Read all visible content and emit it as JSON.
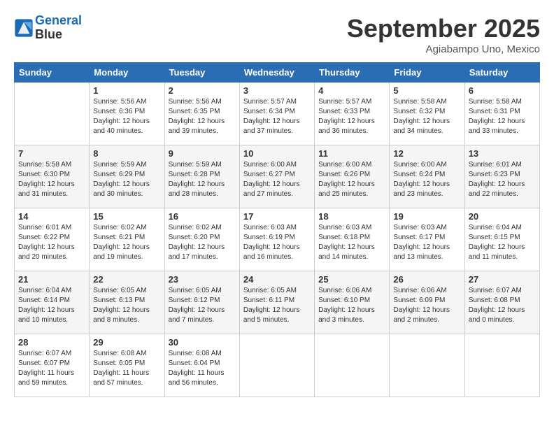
{
  "header": {
    "logo_line1": "General",
    "logo_line2": "Blue",
    "month": "September 2025",
    "location": "Agiabampo Uno, Mexico"
  },
  "days_of_week": [
    "Sunday",
    "Monday",
    "Tuesday",
    "Wednesday",
    "Thursday",
    "Friday",
    "Saturday"
  ],
  "weeks": [
    [
      {
        "day": "",
        "info": ""
      },
      {
        "day": "1",
        "info": "Sunrise: 5:56 AM\nSunset: 6:36 PM\nDaylight: 12 hours\nand 40 minutes."
      },
      {
        "day": "2",
        "info": "Sunrise: 5:56 AM\nSunset: 6:35 PM\nDaylight: 12 hours\nand 39 minutes."
      },
      {
        "day": "3",
        "info": "Sunrise: 5:57 AM\nSunset: 6:34 PM\nDaylight: 12 hours\nand 37 minutes."
      },
      {
        "day": "4",
        "info": "Sunrise: 5:57 AM\nSunset: 6:33 PM\nDaylight: 12 hours\nand 36 minutes."
      },
      {
        "day": "5",
        "info": "Sunrise: 5:58 AM\nSunset: 6:32 PM\nDaylight: 12 hours\nand 34 minutes."
      },
      {
        "day": "6",
        "info": "Sunrise: 5:58 AM\nSunset: 6:31 PM\nDaylight: 12 hours\nand 33 minutes."
      }
    ],
    [
      {
        "day": "7",
        "info": "Sunrise: 5:58 AM\nSunset: 6:30 PM\nDaylight: 12 hours\nand 31 minutes."
      },
      {
        "day": "8",
        "info": "Sunrise: 5:59 AM\nSunset: 6:29 PM\nDaylight: 12 hours\nand 30 minutes."
      },
      {
        "day": "9",
        "info": "Sunrise: 5:59 AM\nSunset: 6:28 PM\nDaylight: 12 hours\nand 28 minutes."
      },
      {
        "day": "10",
        "info": "Sunrise: 6:00 AM\nSunset: 6:27 PM\nDaylight: 12 hours\nand 27 minutes."
      },
      {
        "day": "11",
        "info": "Sunrise: 6:00 AM\nSunset: 6:26 PM\nDaylight: 12 hours\nand 25 minutes."
      },
      {
        "day": "12",
        "info": "Sunrise: 6:00 AM\nSunset: 6:24 PM\nDaylight: 12 hours\nand 23 minutes."
      },
      {
        "day": "13",
        "info": "Sunrise: 6:01 AM\nSunset: 6:23 PM\nDaylight: 12 hours\nand 22 minutes."
      }
    ],
    [
      {
        "day": "14",
        "info": "Sunrise: 6:01 AM\nSunset: 6:22 PM\nDaylight: 12 hours\nand 20 minutes."
      },
      {
        "day": "15",
        "info": "Sunrise: 6:02 AM\nSunset: 6:21 PM\nDaylight: 12 hours\nand 19 minutes."
      },
      {
        "day": "16",
        "info": "Sunrise: 6:02 AM\nSunset: 6:20 PM\nDaylight: 12 hours\nand 17 minutes."
      },
      {
        "day": "17",
        "info": "Sunrise: 6:03 AM\nSunset: 6:19 PM\nDaylight: 12 hours\nand 16 minutes."
      },
      {
        "day": "18",
        "info": "Sunrise: 6:03 AM\nSunset: 6:18 PM\nDaylight: 12 hours\nand 14 minutes."
      },
      {
        "day": "19",
        "info": "Sunrise: 6:03 AM\nSunset: 6:17 PM\nDaylight: 12 hours\nand 13 minutes."
      },
      {
        "day": "20",
        "info": "Sunrise: 6:04 AM\nSunset: 6:15 PM\nDaylight: 12 hours\nand 11 minutes."
      }
    ],
    [
      {
        "day": "21",
        "info": "Sunrise: 6:04 AM\nSunset: 6:14 PM\nDaylight: 12 hours\nand 10 minutes."
      },
      {
        "day": "22",
        "info": "Sunrise: 6:05 AM\nSunset: 6:13 PM\nDaylight: 12 hours\nand 8 minutes."
      },
      {
        "day": "23",
        "info": "Sunrise: 6:05 AM\nSunset: 6:12 PM\nDaylight: 12 hours\nand 7 minutes."
      },
      {
        "day": "24",
        "info": "Sunrise: 6:05 AM\nSunset: 6:11 PM\nDaylight: 12 hours\nand 5 minutes."
      },
      {
        "day": "25",
        "info": "Sunrise: 6:06 AM\nSunset: 6:10 PM\nDaylight: 12 hours\nand 3 minutes."
      },
      {
        "day": "26",
        "info": "Sunrise: 6:06 AM\nSunset: 6:09 PM\nDaylight: 12 hours\nand 2 minutes."
      },
      {
        "day": "27",
        "info": "Sunrise: 6:07 AM\nSunset: 6:08 PM\nDaylight: 12 hours\nand 0 minutes."
      }
    ],
    [
      {
        "day": "28",
        "info": "Sunrise: 6:07 AM\nSunset: 6:07 PM\nDaylight: 11 hours\nand 59 minutes."
      },
      {
        "day": "29",
        "info": "Sunrise: 6:08 AM\nSunset: 6:05 PM\nDaylight: 11 hours\nand 57 minutes."
      },
      {
        "day": "30",
        "info": "Sunrise: 6:08 AM\nSunset: 6:04 PM\nDaylight: 11 hours\nand 56 minutes."
      },
      {
        "day": "",
        "info": ""
      },
      {
        "day": "",
        "info": ""
      },
      {
        "day": "",
        "info": ""
      },
      {
        "day": "",
        "info": ""
      }
    ]
  ]
}
